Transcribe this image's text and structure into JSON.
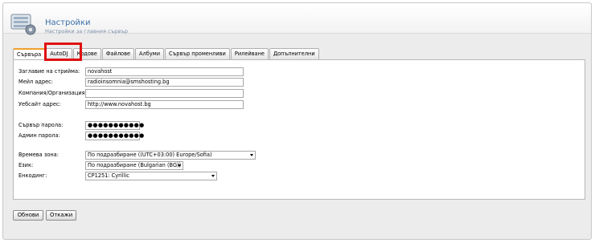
{
  "header": {
    "title": "Настройки",
    "subtitle": "Настройки за главния сървър"
  },
  "tabs": [
    {
      "label": "Сървъра",
      "active": true
    },
    {
      "label": "AutoDJ",
      "active": false
    },
    {
      "label": "Кодове",
      "active": false
    },
    {
      "label": "Файлове",
      "active": false
    },
    {
      "label": "Албуми",
      "active": false
    },
    {
      "label": "Сървър променливи",
      "active": false
    },
    {
      "label": "Рилейване",
      "active": false
    },
    {
      "label": "Допълнителни",
      "active": false
    }
  ],
  "form": {
    "stream_title": {
      "label": "Заглавие на стрийма:",
      "value": "novahost"
    },
    "email": {
      "label": "Мейл адрес:",
      "value": "radioinsomnia@smshosting.bg"
    },
    "company": {
      "label": "Компания/Организация:",
      "value": ""
    },
    "website": {
      "label": "Уебсайт адрес:",
      "value": "http://www.novahost.bg"
    },
    "server_password": {
      "label": "Сървър парола:",
      "value": "●●●●●●●●●●●"
    },
    "admin_password": {
      "label": "Админ парола:",
      "value": "●●●●●●●●●●●"
    },
    "timezone": {
      "label": "Времева зона:",
      "value": "По подразбиране ((UTC+03:00) Europe/Sofia)"
    },
    "language": {
      "label": "Език:",
      "value": "По подразбиране (Bulgarian (BG))"
    },
    "encoding": {
      "label": "Енкодинг:",
      "value": "CP1251: Cyrillic"
    }
  },
  "buttons": {
    "save": "Обнови",
    "cancel": "Откажи"
  },
  "colors": {
    "active_tab_accent": "#f0a030",
    "highlight_box": "#e01010",
    "title_color": "#3a6fa8"
  }
}
